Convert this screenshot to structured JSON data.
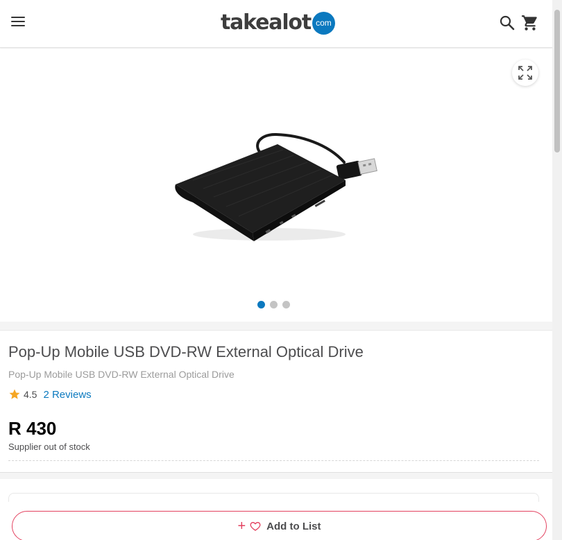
{
  "header": {
    "menu_icon": "hamburger-menu-icon",
    "logo_text": "takealot",
    "logo_badge": "com",
    "search_icon": "search-icon",
    "cart_icon": "cart-icon"
  },
  "gallery": {
    "expand_icon": "fullscreen-expand-icon",
    "image_description_icon": "product-image",
    "dots": [
      {
        "active": true
      },
      {
        "active": false
      },
      {
        "active": false
      }
    ],
    "active_dot_color": "#0b79bf"
  },
  "product": {
    "title": "Pop-Up Mobile USB DVD-RW External Optical Drive",
    "subtitle": "Pop-Up Mobile USB DVD-RW External Optical Drive",
    "rating": "4.5",
    "reviews_label": "2 Reviews",
    "price": "R 430",
    "stock_status": "Supplier out of stock"
  },
  "actions": {
    "add_to_list_plus": "+",
    "add_to_list_label": "Add to List",
    "accent_color": "#e3415f"
  }
}
